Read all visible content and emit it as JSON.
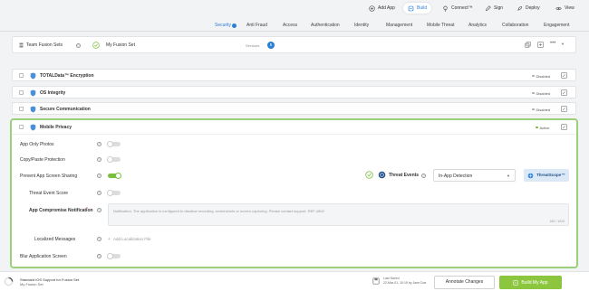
{
  "topbar": {
    "add_app": "Add App",
    "build": "Build",
    "connect": "Connect™",
    "sign": "Sign",
    "deploy": "Deploy",
    "view": "View"
  },
  "tabs": [
    "Security",
    "Anti Fraud",
    "Access",
    "Authentication",
    "Identity",
    "Management",
    "Mobile Threat",
    "Analytics",
    "Collaboration",
    "Engagement"
  ],
  "fusion_set": {
    "label": "Team Fusion Sets",
    "name": "My Fusion Set",
    "services_label": "Services",
    "services_count": "5"
  },
  "sections": [
    {
      "title": "TOTALData™ Encryption",
      "status": "Disabled"
    },
    {
      "title": "OS Integrity",
      "status": "Disabled"
    },
    {
      "title": "Secure Communication",
      "status": "Disabled"
    }
  ],
  "mobile_privacy": {
    "title": "Mobile Privacy",
    "status": "Active",
    "rows": {
      "app_only_photos": "App Only Photos",
      "copy_paste": "Copy/Paste Protection",
      "prevent_screen_sharing": "Prevent App Screen Sharing",
      "threat_event_score": "Threat Event Score",
      "compromise_notification": "App Compromise Notification",
      "required_mark": "*",
      "localized_messages": "Localized Messages",
      "blur_screen": "Blur Application Screen"
    },
    "threat_events_label": "Threat Events",
    "threat_select_value": "In-App Detection",
    "threatscope_label": "ThreatScope™",
    "notification_text": "Notification. The application is configured to disallow recording, screenshots or screen capturing. Please contact support. REF-4802",
    "char_count": "150 / 1024",
    "add_localization": "Add Localization File"
  },
  "toggles": {
    "app_only_photos": 0,
    "copy_paste": 0,
    "prevent_screen_sharing": 1,
    "threat_event_score": 0,
    "blur_screen": 0
  },
  "bottom": {
    "support_line1": "Standard iOS Support for Fusion Set",
    "support_line2": "My Fusion Set",
    "last_saved_label": "Last Saved",
    "last_saved_value": "22-Mar-01, 10:15 by Jane Doe",
    "annotate": "Annotate Changes",
    "build_app": "Build My App"
  },
  "colors": {
    "accent": "#2c7fd6",
    "green": "#7bbf3f",
    "build_button": "#8cc63f",
    "highlight_border": "#9bd07a"
  }
}
